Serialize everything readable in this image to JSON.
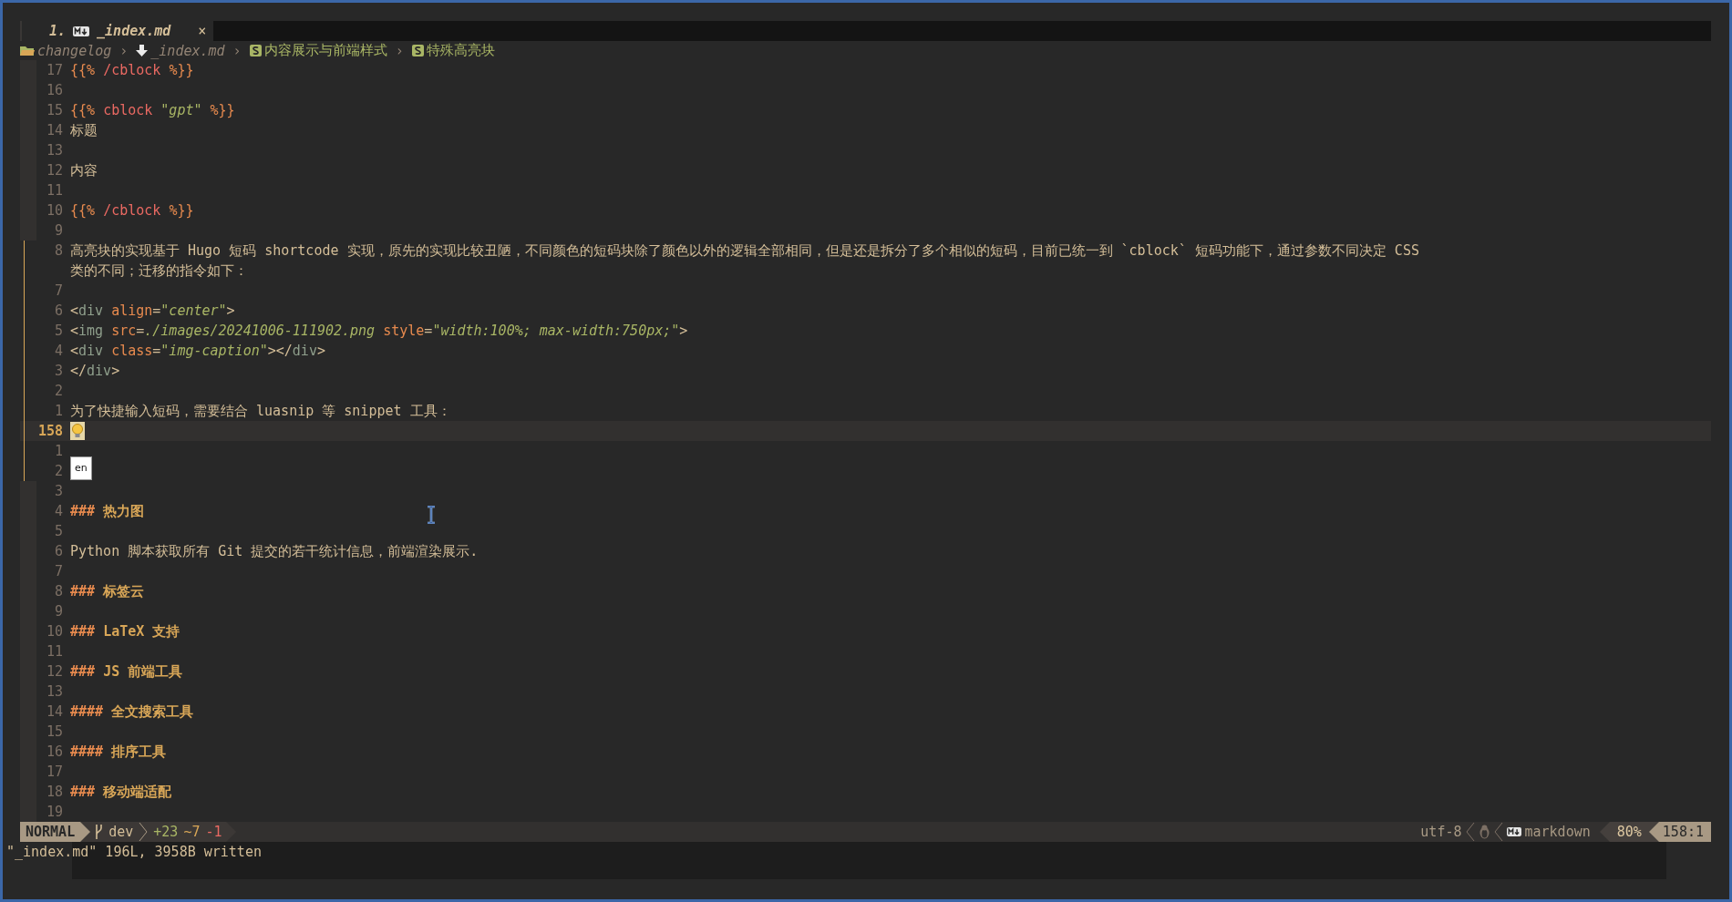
{
  "tab": {
    "number": "1.",
    "title": "_index.md",
    "close": "×",
    "selected": true
  },
  "breadcrumb": [
    {
      "kind": "folder",
      "label": "changelog"
    },
    {
      "kind": "file",
      "sep": "›",
      "label": "_index.md"
    },
    {
      "kind": "section",
      "sep": "›",
      "label": "内容展示与前端样式"
    },
    {
      "kind": "section",
      "sep": "›",
      "label": "特殊高亮块"
    }
  ],
  "lines": [
    {
      "number": "17",
      "changed": false,
      "current": false,
      "rows": [
        [
          {
            "kind": "delim",
            "t": "{{% "
          },
          {
            "kind": "keyword",
            "t": "/cblock "
          },
          {
            "kind": "delim",
            "t": "%}}"
          }
        ]
      ]
    },
    {
      "number": "16",
      "changed": false,
      "current": false,
      "rows": [
        []
      ]
    },
    {
      "number": "15",
      "changed": false,
      "current": false,
      "rows": [
        [
          {
            "kind": "delim",
            "t": "{{% "
          },
          {
            "kind": "keyword",
            "t": "cblock "
          },
          {
            "kind": "string",
            "t": "\"gpt\""
          },
          {
            "kind": "delim",
            "t": " %}}"
          }
        ]
      ]
    },
    {
      "number": "14",
      "changed": false,
      "current": false,
      "rows": [
        [
          {
            "kind": "plain",
            "t": "标题"
          }
        ]
      ]
    },
    {
      "number": "13",
      "changed": false,
      "current": false,
      "rows": [
        []
      ]
    },
    {
      "number": "12",
      "changed": false,
      "current": false,
      "rows": [
        [
          {
            "kind": "plain",
            "t": "内容"
          }
        ]
      ]
    },
    {
      "number": "11",
      "changed": false,
      "current": false,
      "rows": [
        []
      ]
    },
    {
      "number": "10",
      "changed": false,
      "current": false,
      "rows": [
        [
          {
            "kind": "delim",
            "t": "{{% "
          },
          {
            "kind": "keyword",
            "t": "/cblock "
          },
          {
            "kind": "delim",
            "t": "%}}"
          }
        ]
      ]
    },
    {
      "number": "9",
      "changed": false,
      "current": false,
      "rows": [
        []
      ]
    },
    {
      "number": "8",
      "changed": true,
      "current": false,
      "rows": [
        [
          {
            "kind": "plain",
            "t": "高亮块的实现基于 Hugo 短码 shortcode 实现，原先的实现比较丑陋，不同颜色的短码块除了颜色以外的逻辑全部相同，但是还是拆分了多个相似的短码，目前已统一到 `cblock` 短码功能下，通过参数不同决定 CSS"
          }
        ],
        [
          {
            "kind": "plain",
            "t": "类的不同；迁移的指令如下："
          }
        ]
      ]
    },
    {
      "number": "7",
      "changed": true,
      "current": false,
      "rows": [
        []
      ]
    },
    {
      "number": "6",
      "changed": true,
      "current": false,
      "rows": [
        [
          {
            "kind": "bracket",
            "t": "<"
          },
          {
            "kind": "tag",
            "t": "div "
          },
          {
            "kind": "attr",
            "t": "align"
          },
          {
            "kind": "bracket",
            "t": "="
          },
          {
            "kind": "string",
            "t": "\"center\""
          },
          {
            "kind": "bracket",
            "t": ">"
          }
        ]
      ]
    },
    {
      "number": "5",
      "changed": true,
      "current": false,
      "rows": [
        [
          {
            "kind": "bracket",
            "t": "<"
          },
          {
            "kind": "tag",
            "t": "img "
          },
          {
            "kind": "attr",
            "t": "src"
          },
          {
            "kind": "bracket",
            "t": "="
          },
          {
            "kind": "string",
            "t": "./images/20241006-111902.png "
          },
          {
            "kind": "attr",
            "t": "style"
          },
          {
            "kind": "bracket",
            "t": "="
          },
          {
            "kind": "string",
            "t": "\"width:100%; max-width:750px;\""
          },
          {
            "kind": "bracket",
            "t": ">"
          }
        ]
      ]
    },
    {
      "number": "4",
      "changed": true,
      "current": false,
      "rows": [
        [
          {
            "kind": "bracket",
            "t": "<"
          },
          {
            "kind": "tag",
            "t": "div "
          },
          {
            "kind": "attr",
            "t": "class"
          },
          {
            "kind": "bracket",
            "t": "="
          },
          {
            "kind": "string",
            "t": "\"img-caption\""
          },
          {
            "kind": "bracket",
            "t": "></"
          },
          {
            "kind": "tag",
            "t": "div"
          },
          {
            "kind": "bracket",
            "t": ">"
          }
        ]
      ]
    },
    {
      "number": "3",
      "changed": true,
      "current": false,
      "rows": [
        [
          {
            "kind": "bracket",
            "t": "</"
          },
          {
            "kind": "tag",
            "t": "div"
          },
          {
            "kind": "bracket",
            "t": ">"
          }
        ]
      ]
    },
    {
      "number": "2",
      "changed": true,
      "current": false,
      "rows": [
        []
      ]
    },
    {
      "number": "1",
      "changed": true,
      "current": false,
      "rows": [
        [
          {
            "kind": "plain",
            "t": "为了快捷输入短码，需要结合 luasnip 等 snippet 工具："
          }
        ]
      ]
    },
    {
      "number": "158",
      "changed": true,
      "current": true,
      "code_action": true,
      "rows": [
        []
      ]
    },
    {
      "number": "1",
      "changed": true,
      "current": false,
      "rows": [
        []
      ]
    },
    {
      "number": "2",
      "changed": true,
      "current": false,
      "rows": [
        [
          {
            "kind": "badge",
            "t": "en"
          }
        ]
      ]
    },
    {
      "number": "3",
      "changed": false,
      "current": false,
      "rows": [
        []
      ]
    },
    {
      "number": "4",
      "changed": false,
      "current": false,
      "rows": [
        [
          {
            "kind": "hmark",
            "t": "### "
          },
          {
            "kind": "heading",
            "t": "热力图"
          }
        ]
      ]
    },
    {
      "number": "5",
      "changed": false,
      "current": false,
      "rows": [
        []
      ]
    },
    {
      "number": "6",
      "changed": false,
      "current": false,
      "rows": [
        [
          {
            "kind": "plain",
            "t": "Python 脚本获取所有 Git 提交的若干统计信息，前端渲染展示."
          }
        ]
      ]
    },
    {
      "number": "7",
      "changed": false,
      "current": false,
      "rows": [
        []
      ]
    },
    {
      "number": "8",
      "changed": false,
      "current": false,
      "rows": [
        [
          {
            "kind": "hmark",
            "t": "### "
          },
          {
            "kind": "heading",
            "t": "标签云"
          }
        ]
      ]
    },
    {
      "number": "9",
      "changed": false,
      "current": false,
      "rows": [
        []
      ]
    },
    {
      "number": "10",
      "changed": false,
      "current": false,
      "rows": [
        [
          {
            "kind": "hmark",
            "t": "### "
          },
          {
            "kind": "heading",
            "t": "LaTeX 支持"
          }
        ]
      ]
    },
    {
      "number": "11",
      "changed": false,
      "current": false,
      "rows": [
        []
      ]
    },
    {
      "number": "12",
      "changed": false,
      "current": false,
      "rows": [
        [
          {
            "kind": "hmark",
            "t": "### "
          },
          {
            "kind": "heading",
            "t": "JS 前端工具"
          }
        ]
      ]
    },
    {
      "number": "13",
      "changed": false,
      "current": false,
      "rows": [
        []
      ]
    },
    {
      "number": "14",
      "changed": false,
      "current": false,
      "rows": [
        [
          {
            "kind": "hmark",
            "t": "#### "
          },
          {
            "kind": "heading",
            "t": "全文搜索工具"
          }
        ]
      ]
    },
    {
      "number": "15",
      "changed": false,
      "current": false,
      "rows": [
        []
      ]
    },
    {
      "number": "16",
      "changed": false,
      "current": false,
      "rows": [
        [
          {
            "kind": "hmark",
            "t": "#### "
          },
          {
            "kind": "heading",
            "t": "排序工具"
          }
        ]
      ]
    },
    {
      "number": "17",
      "changed": false,
      "current": false,
      "rows": [
        []
      ]
    },
    {
      "number": "18",
      "changed": false,
      "current": false,
      "rows": [
        [
          {
            "kind": "hmark",
            "t": "### "
          },
          {
            "kind": "heading",
            "t": "移动端适配"
          }
        ]
      ]
    },
    {
      "number": "19",
      "changed": false,
      "current": false,
      "rows": [
        []
      ]
    }
  ],
  "status_bar": {
    "mode": "NORMAL",
    "branch": "dev",
    "added": "+23",
    "changed": "~7",
    "removed": "-1",
    "encoding": "utf-8",
    "filetype": "markdown",
    "progress": "80%",
    "position": "158:1"
  },
  "message": "\"_index.md\" 196L, 3958B written"
}
